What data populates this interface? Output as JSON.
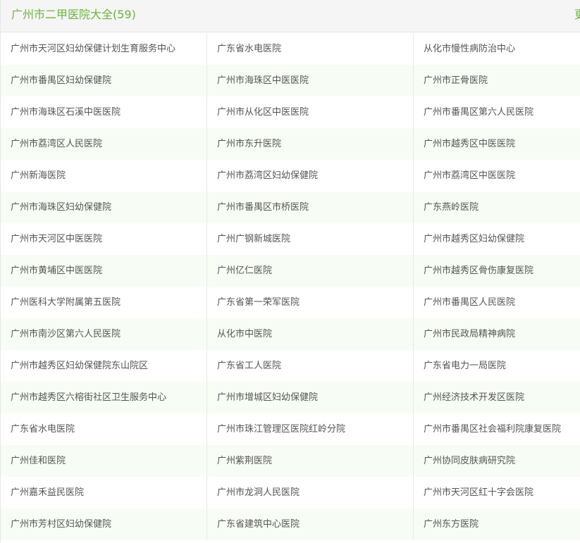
{
  "header": {
    "title": "广州市二甲医院大全(59)",
    "more_label": "更"
  },
  "hospitals": [
    [
      "广州市天河区妇幼保健计划生育服务中心",
      "广东省水电医院",
      "从化市慢性病防治中心"
    ],
    [
      "广州市番禺区妇幼保健院",
      "广州市海珠区中医医院",
      "广州市正骨医院"
    ],
    [
      "广州市海珠区石溪中医医院",
      "广州市从化区中医医院",
      "广州市番禺区第六人民医院"
    ],
    [
      "广州市荔湾区人民医院",
      "广州市东升医院",
      "广州市越秀区中医医院"
    ],
    [
      "广州新海医院",
      "广州市荔湾区妇幼保健院",
      "广州市荔湾区中医医院"
    ],
    [
      "广州市海珠区妇幼保健院",
      "广州市番禺区市桥医院",
      "广东燕岭医院"
    ],
    [
      "广州市天河区中医医院",
      "广州广钢新城医院",
      "广州市越秀区妇幼保健院"
    ],
    [
      "广州市黄埔区中医医院",
      "广州亿仁医院",
      "广州市越秀区骨伤康复医院"
    ],
    [
      "广州医科大学附属第五医院",
      "广东省第一荣军医院",
      "广州市番禺区人民医院"
    ],
    [
      "广州市南沙区第六人民医院",
      "从化市中医院",
      "广州市民政局精神病院"
    ],
    [
      "广州市越秀区妇幼保健院东山院区",
      "广东省工人医院",
      "广东省电力一局医院"
    ],
    [
      "广州市越秀区六榕街社区卫生服务中心",
      "广州市增城区妇幼保健院",
      "广州经济技术开发区医院"
    ],
    [
      "广东省水电医院",
      "广州市珠江管理区医院红岭分院",
      "广州市番禺区社会福利院康复医院"
    ],
    [
      "广州佳和医院",
      "广州紫荆医院",
      "广州协同皮肤病研究院"
    ],
    [
      "广州嘉禾益民医院",
      "广州市龙洞人民医院",
      "广州市天河区红十字会医院"
    ],
    [
      "广州市芳村区妇幼保健院",
      "广东省建筑中心医院",
      "广州东方医院"
    ]
  ],
  "colors": {
    "accent": "#6db33f",
    "header_bg": "#f5f5f5",
    "alt_row_bg": "#f7fdf4",
    "border": "#e8e8e8",
    "text": "#555555"
  }
}
